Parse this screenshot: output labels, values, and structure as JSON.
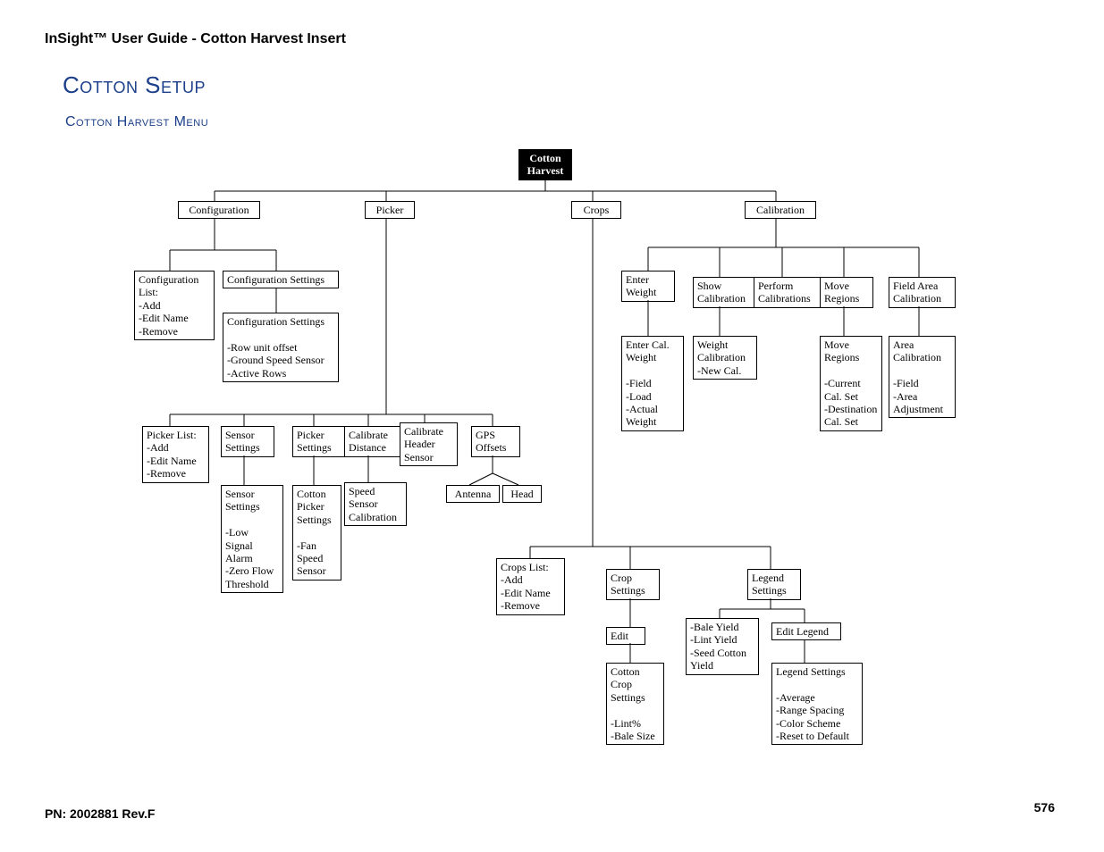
{
  "doc": {
    "header": "InSight™ User Guide - Cotton Harvest Insert",
    "h1": "Cotton Setup",
    "h2": "Cotton Harvest Menu",
    "pn": "PN: 2002881 Rev.F",
    "page": "576"
  },
  "root": {
    "l1": "Cotton",
    "l2": "Harvest"
  },
  "lvl1": {
    "config": "Configuration",
    "picker": "Picker",
    "crops": "Crops",
    "calib": "Calibration"
  },
  "config": {
    "list": "Configuration\nList:\n-Add\n-Edit Name\n-Remove",
    "set1": "Configuration Settings",
    "set2": "Configuration Settings\n\n-Row unit offset\n-Ground Speed Sensor\n-Active Rows"
  },
  "picker": {
    "list": "Picker List:\n-Add\n-Edit Name\n-Remove",
    "sensor": "Sensor\nSettings",
    "sensor2": "Sensor\nSettings\n\n-Low\nSignal\nAlarm\n-Zero Flow\nThreshold",
    "pset": "Picker\nSettings",
    "pset2": "Cotton\nPicker\nSettings\n\n-Fan\nSpeed\nSensor",
    "cdist": "Calibrate\nDistance",
    "cdist2": "Speed\nSensor\nCalibration",
    "chdr": "Calibrate\nHeader\nSensor",
    "gps": "GPS\nOffsets",
    "ant": "Antenna",
    "head": "Head"
  },
  "crops": {
    "list": "Crops List:\n-Add\n-Edit Name\n-Remove",
    "cset": "Crop\nSettings",
    "edit": "Edit",
    "edit2": "Cotton\nCrop\nSettings\n\n-Lint%\n-Bale Size",
    "leg": "Legend\nSettings",
    "leg2": "-Bale Yield\n-Lint Yield\n-Seed Cotton\nYield",
    "editleg": "Edit Legend",
    "legset": "Legend Settings\n\n-Average\n-Range Spacing\n-Color Scheme\n-Reset to Default"
  },
  "calib": {
    "ew": "Enter\nWeight",
    "ew2": "Enter Cal.\nWeight\n\n-Field\n-Load\n-Actual\nWeight",
    "show": "Show\nCalibration",
    "show2": "Weight\nCalibration\n-New Cal.",
    "perf": "Perform\nCalibrations",
    "move": "Move\nRegions",
    "move2": "Move\nRegions\n\n-Current\nCal. Set\n-Destination\nCal. Set",
    "fac": "Field Area\nCalibration",
    "fac2": "Area\nCalibration\n\n-Field\n-Area\nAdjustment"
  }
}
